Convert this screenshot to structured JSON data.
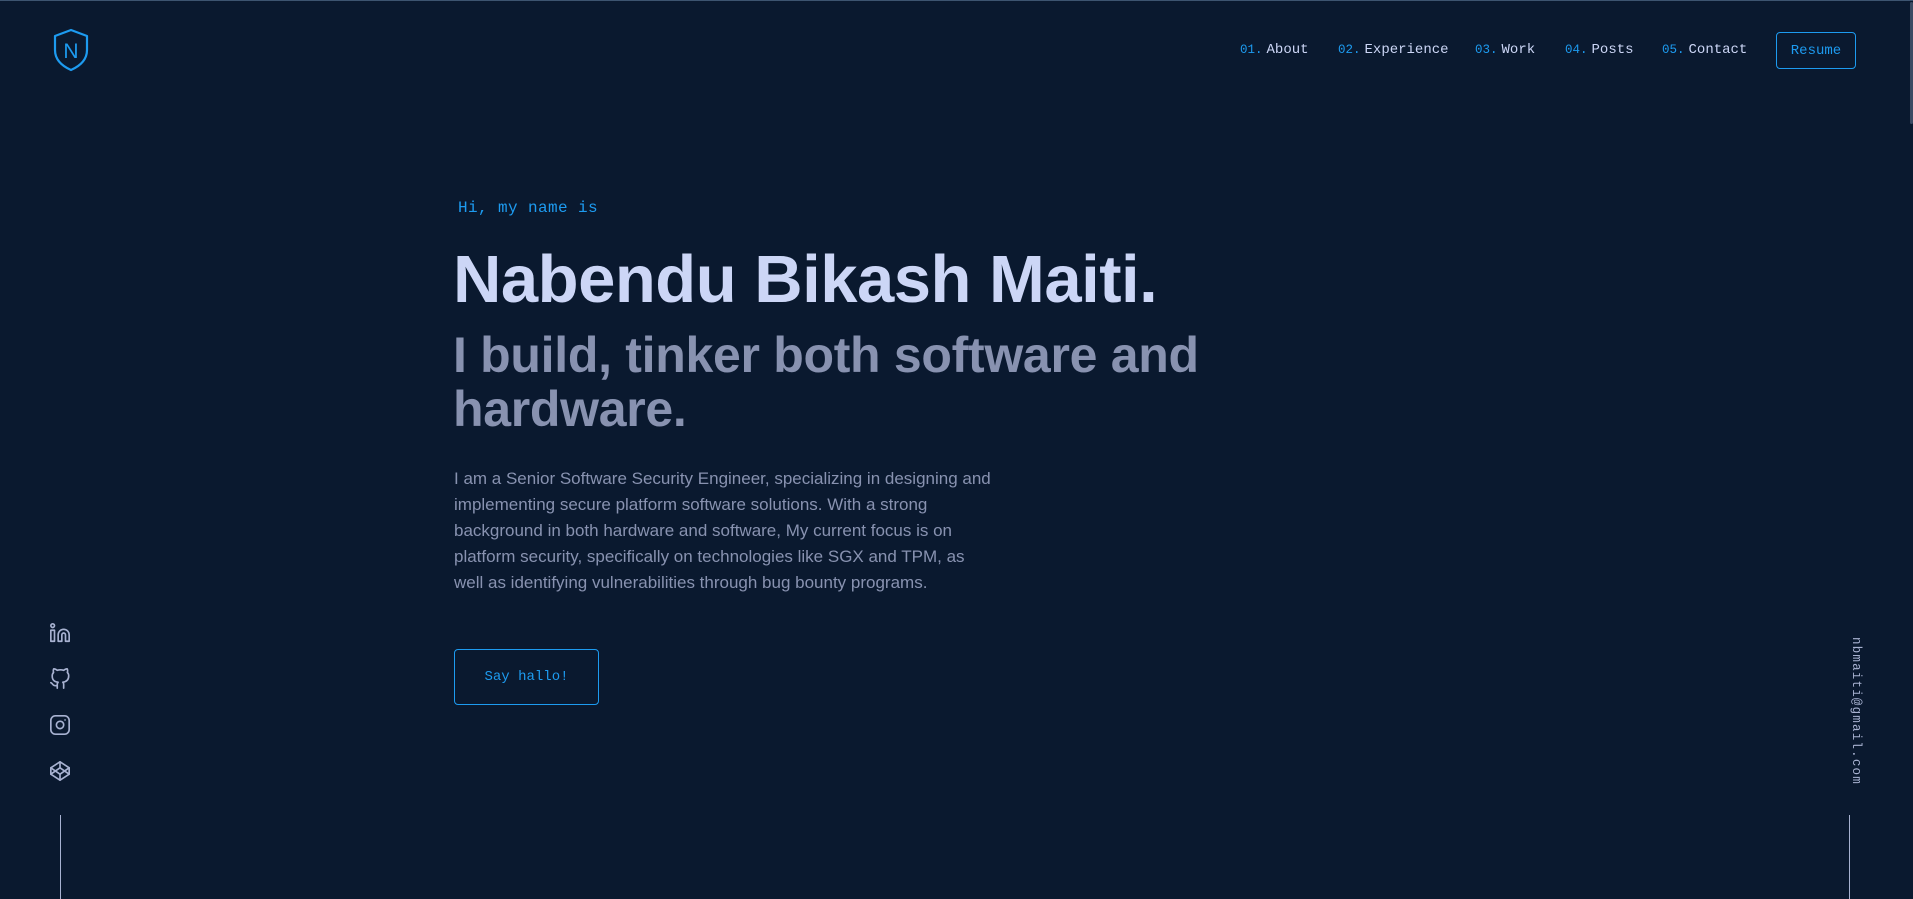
{
  "header": {
    "logo_letter": "N",
    "nav": [
      {
        "num": "01.",
        "label": "About"
      },
      {
        "num": "02.",
        "label": "Experience"
      },
      {
        "num": "03.",
        "label": "Work"
      },
      {
        "num": "04.",
        "label": "Posts"
      },
      {
        "num": "05.",
        "label": "Contact"
      }
    ],
    "resume_label": "Resume"
  },
  "hero": {
    "greeting": "Hi, my name is",
    "name": "Nabendu Bikash Maiti.",
    "tagline": "I build, tinker both software and hardware.",
    "bio": "I am a Senior Software Security Engineer, specializing in designing and implementing secure platform software solutions. With a strong background in both hardware and software, My current focus is on platform security, specifically on technologies like SGX and TPM, as well as identifying vulnerabilities through bug bounty programs.",
    "cta_label": "Say hallo!"
  },
  "social": [
    {
      "icon": "linkedin-icon"
    },
    {
      "icon": "github-icon"
    },
    {
      "icon": "instagram-icon"
    },
    {
      "icon": "codepen-icon"
    }
  ],
  "email": "nbmaiti@gmail.com",
  "colors": {
    "background": "#0a192f",
    "accent": "#1d9bf0",
    "heading": "#ccd6f6",
    "text": "#8892b0"
  }
}
